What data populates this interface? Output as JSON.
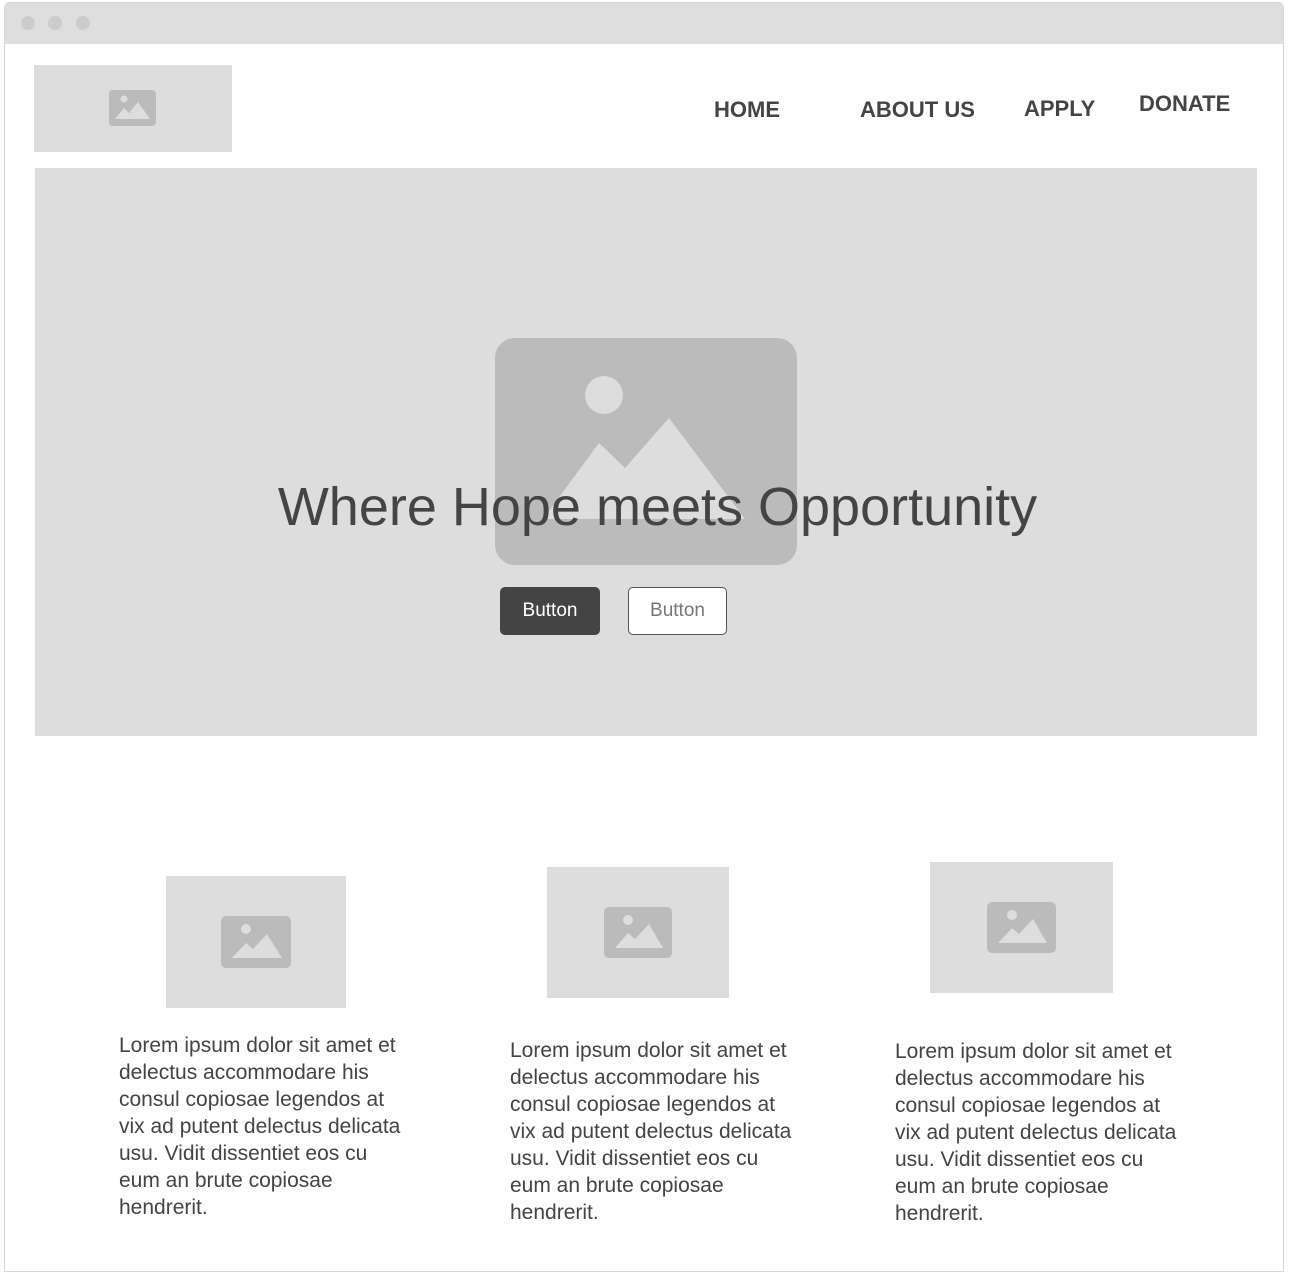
{
  "nav": {
    "items": [
      {
        "label": "HOME"
      },
      {
        "label": "ABOUT US"
      },
      {
        "label": "APPLY"
      },
      {
        "label": "DONATE"
      }
    ]
  },
  "hero": {
    "title": "Where Hope meets Opportunity",
    "primary_button": "Button",
    "secondary_button": "Button"
  },
  "cards": [
    {
      "text": "Lorem ipsum dolor sit amet et delectus accommodare his consul copiosae legendos at vix ad putent delectus delicata usu. Vidit dissentiet eos cu eum an brute copiosae hendrerit."
    },
    {
      "text": "Lorem ipsum dolor sit amet et delectus accommodare his consul copiosae legendos at vix ad putent delectus delicata usu. Vidit dissentiet eos cu eum an brute copiosae hendrerit."
    },
    {
      "text": "Lorem ipsum dolor sit amet et delectus accommodare his consul copiosae legendos at vix ad putent delectus delicata usu. Vidit dissentiet eos cu eum an brute copiosae hendrerit."
    }
  ],
  "colors": {
    "placeholder": "#dddddd",
    "placeholder_icon": "#bbbbbb",
    "text": "#444444",
    "titlebar": "#dedede"
  }
}
